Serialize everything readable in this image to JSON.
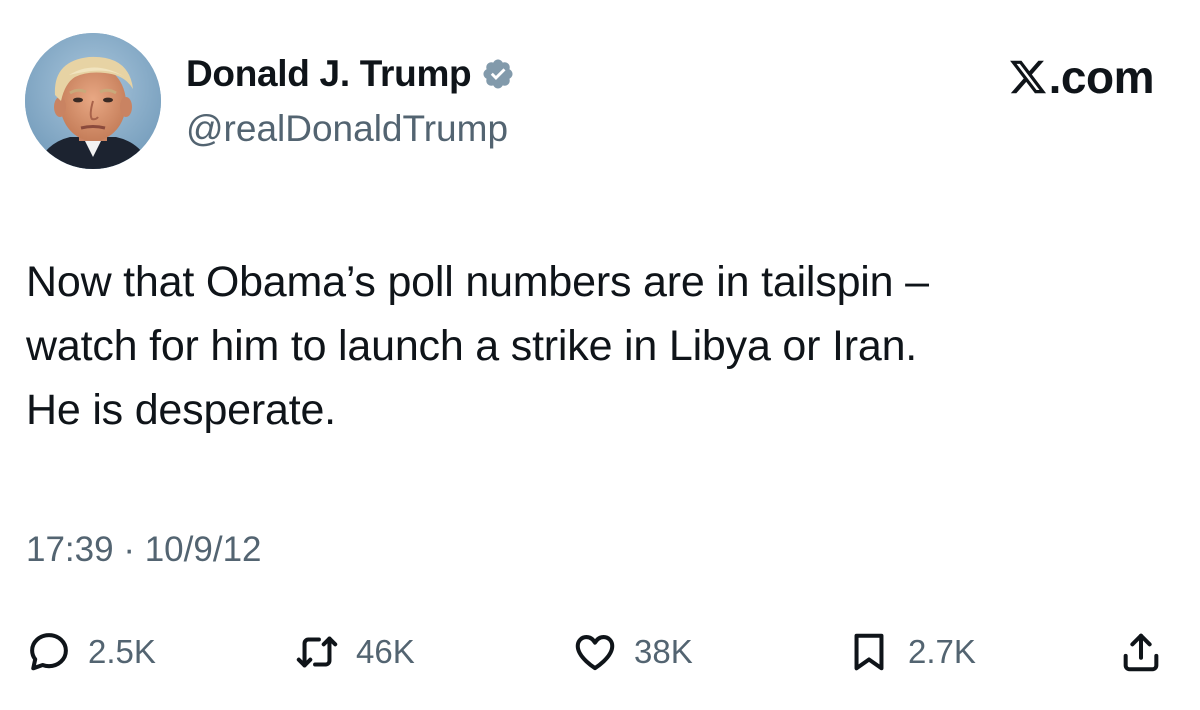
{
  "author": {
    "display_name": "Donald J. Trump",
    "handle": "@realDonaldTrump",
    "verified": true
  },
  "brand": {
    "suffix": ".com"
  },
  "tweet": {
    "text": "Now that Obama’s poll numbers are in tailspin –\nwatch for him to launch a strike in Libya or Iran.\nHe is desperate.",
    "time": "17:39",
    "separator": "·",
    "date": "10/9/12"
  },
  "metrics": {
    "replies": "2.5K",
    "reposts": "46K",
    "likes": "38K",
    "bookmarks": "2.7K"
  },
  "icons": {
    "verified": "verified-badge-icon",
    "reply": "reply-bubble-icon",
    "repost": "repost-arrows-icon",
    "like": "heart-icon",
    "bookmark": "bookmark-icon",
    "share": "share-upload-icon",
    "brand": "x-logo-icon"
  },
  "colors": {
    "text": "#0f1419",
    "secondary": "#536471",
    "verified_badge": "#829aab"
  }
}
